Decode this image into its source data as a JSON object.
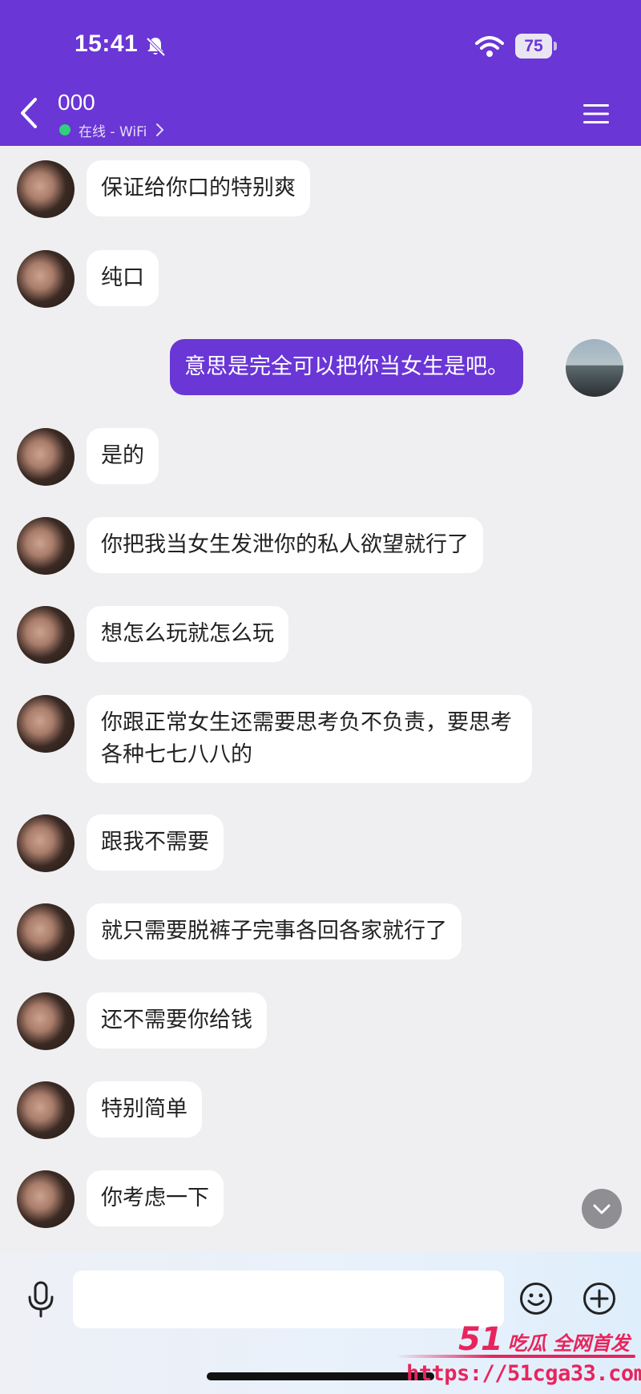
{
  "status_bar": {
    "time": "15:41",
    "battery": "75"
  },
  "header": {
    "title": "000",
    "subtitle": "在线 - WiFi"
  },
  "messages": [
    {
      "from": "her",
      "text": "保证给你口的特别爽"
    },
    {
      "from": "her",
      "text": "纯口"
    },
    {
      "from": "me",
      "text": "意思是完全可以把你当女生是吧。"
    },
    {
      "from": "her",
      "text": "是的"
    },
    {
      "from": "her",
      "text": "你把我当女生发泄你的私人欲望就行了"
    },
    {
      "from": "her",
      "text": "想怎么玩就怎么玩"
    },
    {
      "from": "her",
      "text": "你跟正常女生还需要思考负不负责，要思考各种七七八八的"
    },
    {
      "from": "her",
      "text": "跟我不需要"
    },
    {
      "from": "her",
      "text": "就只需要脱裤子完事各回各家就行了"
    },
    {
      "from": "her",
      "text": "还不需要你给钱"
    },
    {
      "from": "her",
      "text": "特别简单"
    },
    {
      "from": "her",
      "text": "你考虑一下"
    }
  ],
  "input": {
    "value": "",
    "placeholder": ""
  },
  "watermark": {
    "brand": "51",
    "tag": "吃瓜 全网首发",
    "url": "https://51cga33.com"
  },
  "colors": {
    "accent": "#6a36d6",
    "online": "#2fd27a",
    "watermark": "#e8245d"
  },
  "icons": [
    "bell-muted-icon",
    "wifi-icon",
    "back-icon",
    "menu-icon",
    "mic-icon",
    "emoji-icon",
    "plus-icon",
    "chevron-down-icon"
  ]
}
